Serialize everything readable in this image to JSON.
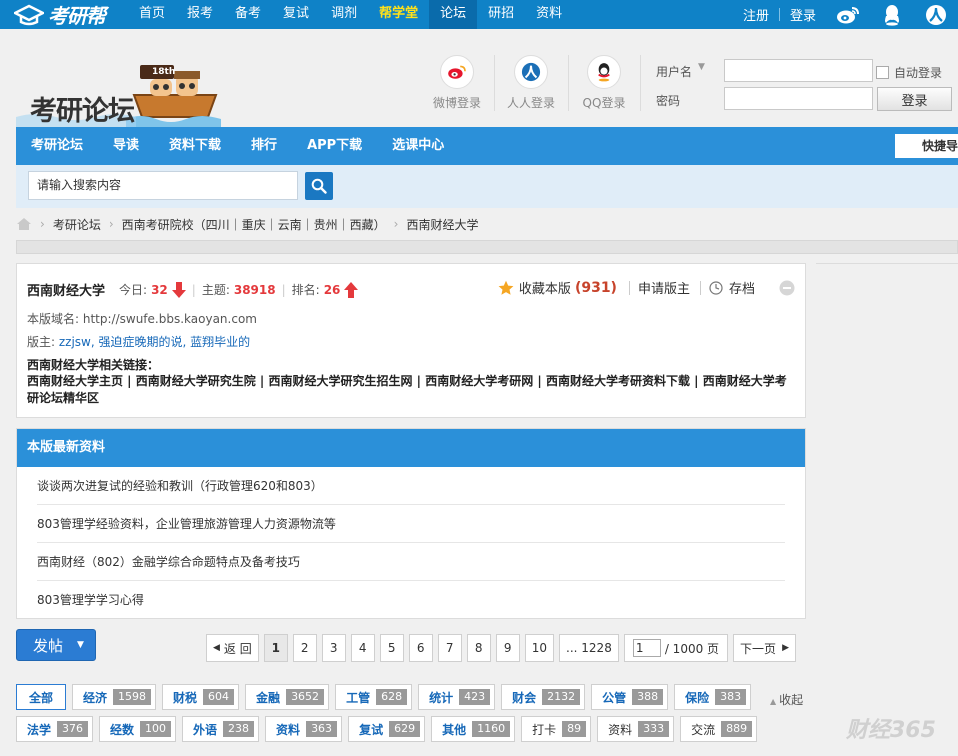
{
  "topnav": {
    "logo_text": "考研帮",
    "items": [
      "首页",
      "报考",
      "备考",
      "复试",
      "调剂",
      "帮学堂",
      "论坛",
      "研招",
      "资料"
    ],
    "register": "注册",
    "login": "登录"
  },
  "header": {
    "brand_badge": "18th",
    "brand_text": "考研论坛",
    "social": [
      "微博登录",
      "人人登录",
      "QQ登录"
    ],
    "login": {
      "username_label": "用户名",
      "password_label": "密码",
      "auto_login": "自动登录",
      "submit": "登录"
    }
  },
  "forum_menu": {
    "items": [
      "考研论坛",
      "导读",
      "资料下载",
      "排行",
      "APP下载",
      "选课中心"
    ],
    "quick": "快捷导航"
  },
  "search": {
    "placeholder": "请输入搜索内容"
  },
  "breadcrumb": [
    "考研论坛",
    "西南考研院校（四川｜重庆｜云南｜贵州｜西藏）",
    "西南财经大学"
  ],
  "forum": {
    "name": "西南财经大学",
    "today_label": "今日:",
    "today": "32",
    "topics_label": "主题:",
    "topics": "38918",
    "rank_label": "排名:",
    "rank": "26",
    "favorite_label": "收藏本版",
    "favorite_count": "(931)",
    "apply_moderator": "申请版主",
    "archive": "存档",
    "domain_label": "本版域名:",
    "domain": "http://swufe.bbs.kaoyan.com",
    "moderators_label": "版主:",
    "moderators": "zzjsw, 强迫症晚期的说, 蓝翔毕业的",
    "related_label": "西南财经大学相关链接：",
    "related_links": "西南财经大学主页 | 西南财经大学研究生院 | 西南财经大学研究生招生网 | 西南财经大学考研网 | 西南财经大学考研资料下载 | 西南财经大学考研论坛精华区"
  },
  "news": {
    "title": "本版最新资料",
    "items": [
      "谈谈两次进复试的经验和教训（行政管理620和803）",
      "803管理学经验资料，企业管理旅游管理人力资源物流等",
      "西南财经（802）金融学综合命题特点及备考技巧",
      "803管理学学习心得"
    ]
  },
  "actions": {
    "post": "发帖"
  },
  "pager": {
    "back": "返 回",
    "pages": [
      "1",
      "2",
      "3",
      "4",
      "5",
      "6",
      "7",
      "8",
      "9",
      "10"
    ],
    "last": "... 1228",
    "input_value": "1",
    "total": "/ 1000 页",
    "next": "下一页"
  },
  "tags_row1": [
    {
      "label": "全部",
      "count": ""
    },
    {
      "label": "经济",
      "count": "1598"
    },
    {
      "label": "财税",
      "count": "604"
    },
    {
      "label": "金融",
      "count": "3652"
    },
    {
      "label": "工管",
      "count": "628"
    },
    {
      "label": "统计",
      "count": "423"
    },
    {
      "label": "财会",
      "count": "2132"
    },
    {
      "label": "公管",
      "count": "388"
    },
    {
      "label": "保险",
      "count": "383"
    }
  ],
  "tags_row2": [
    {
      "label": "法学",
      "count": "376"
    },
    {
      "label": "经数",
      "count": "100"
    },
    {
      "label": "外语",
      "count": "238"
    },
    {
      "label": "资料",
      "count": "363"
    },
    {
      "label": "复试",
      "count": "629"
    },
    {
      "label": "其他",
      "count": "1160"
    },
    {
      "label": "打卡",
      "count": "89"
    },
    {
      "label": "资料",
      "count": "333"
    },
    {
      "label": "交流",
      "count": "889"
    }
  ],
  "collapse": "收起",
  "watermark": "财经365",
  "colors": {
    "primary": "#2b90d9",
    "topbar": "#0f82c7",
    "accent_red": "#e4393c"
  }
}
